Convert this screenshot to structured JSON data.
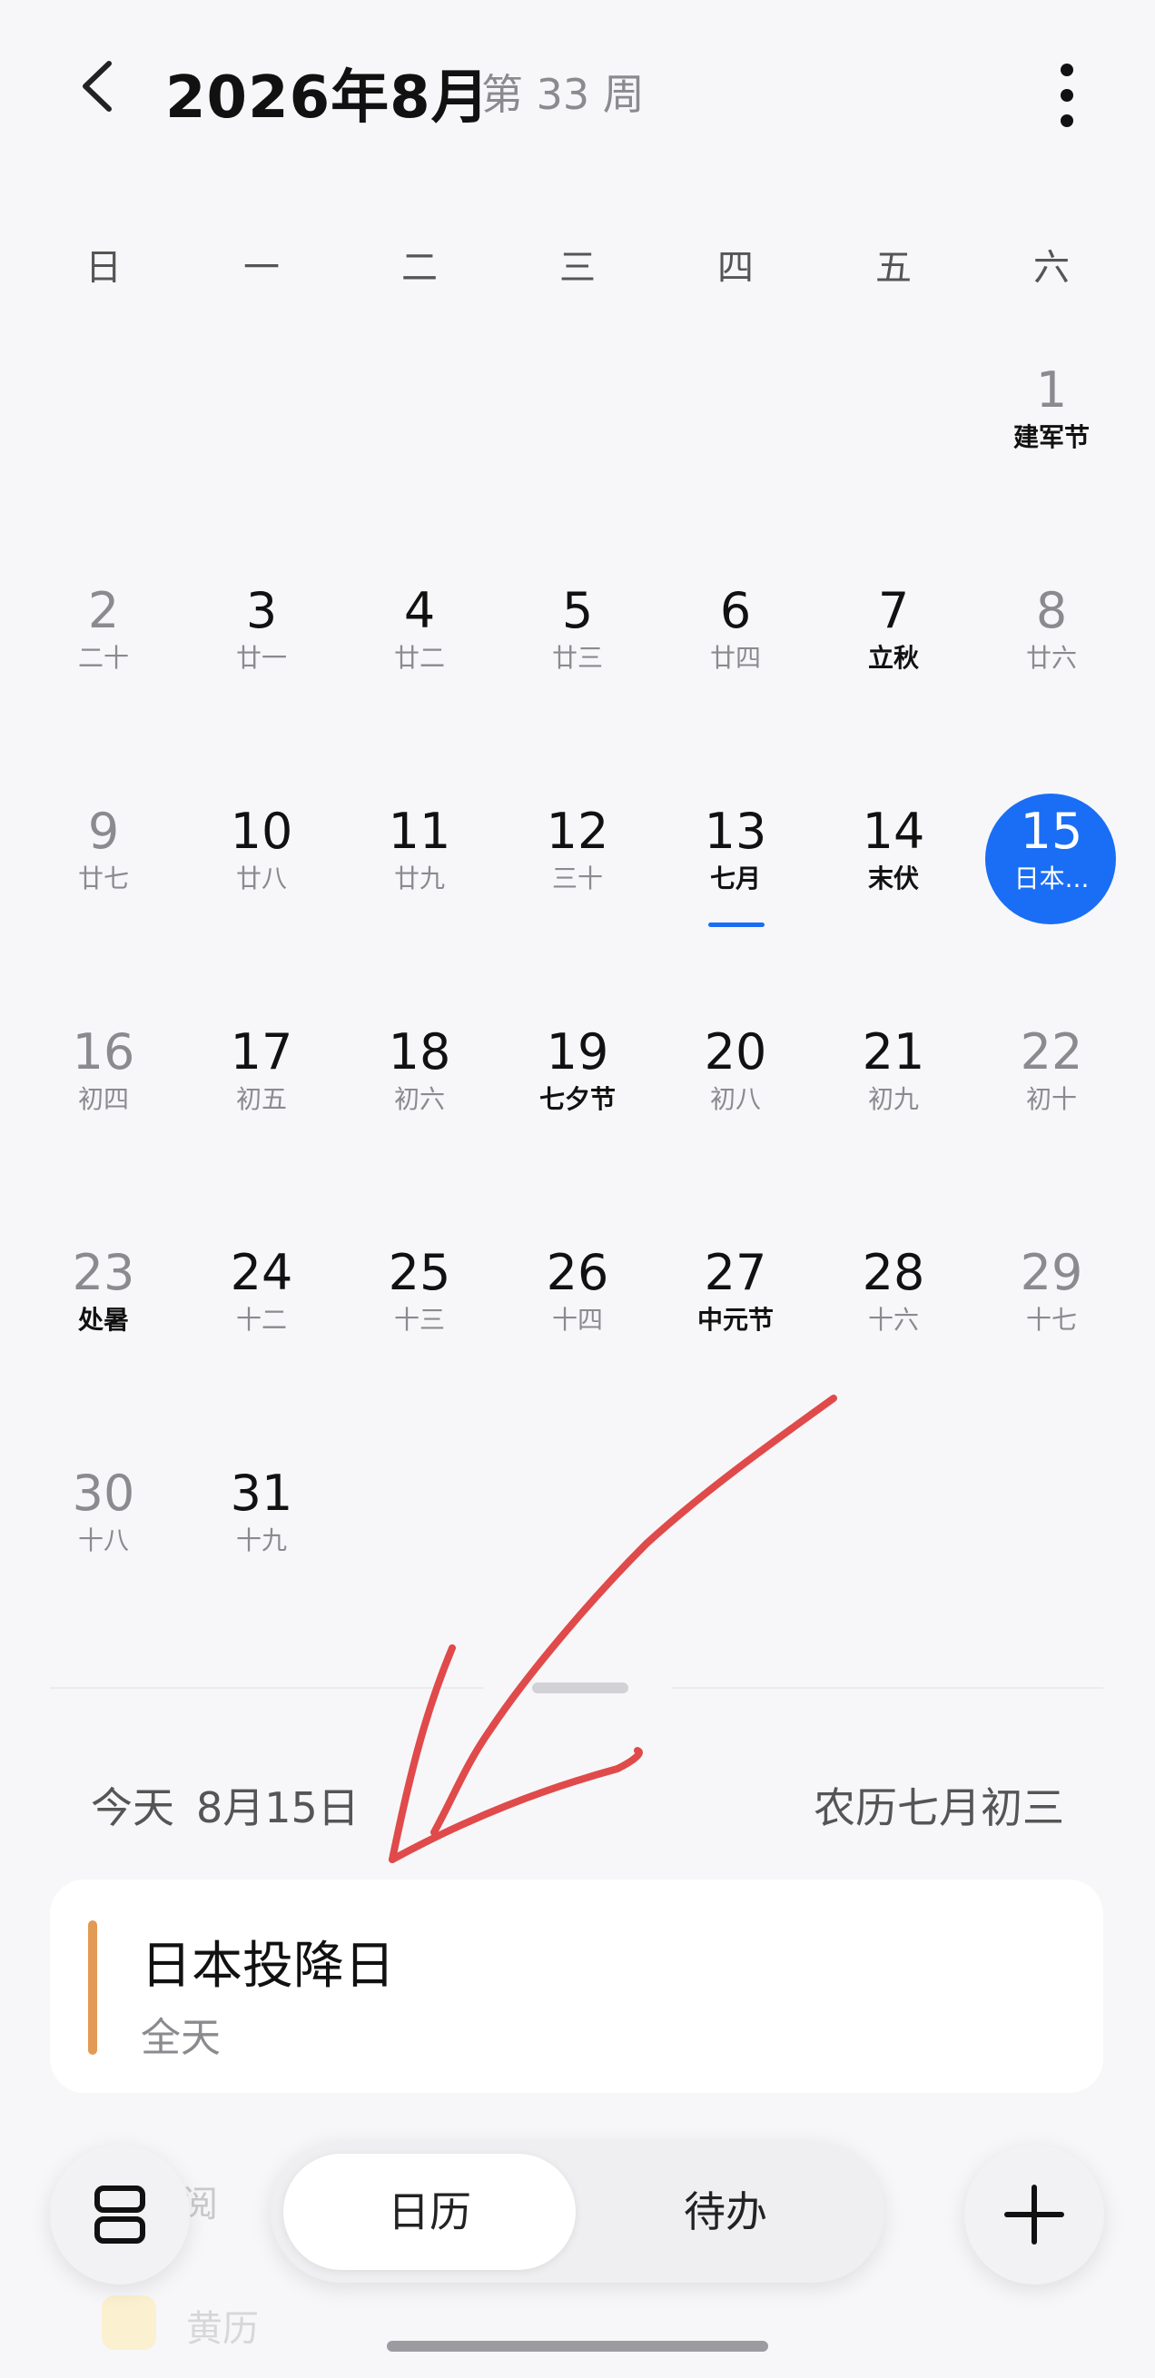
{
  "header": {
    "title": "2026年8月",
    "week": "第 33 周"
  },
  "weekdays": [
    "日",
    "一",
    "二",
    "三",
    "四",
    "五",
    "六"
  ],
  "calendar": [
    {
      "day": "1",
      "lunar": "建军节",
      "col": 6,
      "row": 0,
      "weekend": true,
      "hl": true
    },
    {
      "day": "2",
      "lunar": "二十",
      "col": 0,
      "row": 1,
      "weekend": true
    },
    {
      "day": "3",
      "lunar": "廿一",
      "col": 1,
      "row": 1
    },
    {
      "day": "4",
      "lunar": "廿二",
      "col": 2,
      "row": 1
    },
    {
      "day": "5",
      "lunar": "廿三",
      "col": 3,
      "row": 1
    },
    {
      "day": "6",
      "lunar": "廿四",
      "col": 4,
      "row": 1
    },
    {
      "day": "7",
      "lunar": "立秋",
      "col": 5,
      "row": 1,
      "hl": true
    },
    {
      "day": "8",
      "lunar": "廿六",
      "col": 6,
      "row": 1,
      "weekend": true
    },
    {
      "day": "9",
      "lunar": "廿七",
      "col": 0,
      "row": 2,
      "weekend": true
    },
    {
      "day": "10",
      "lunar": "廿八",
      "col": 1,
      "row": 2
    },
    {
      "day": "11",
      "lunar": "廿九",
      "col": 2,
      "row": 2
    },
    {
      "day": "12",
      "lunar": "三十",
      "col": 3,
      "row": 2
    },
    {
      "day": "13",
      "lunar": "七月",
      "col": 4,
      "row": 2,
      "hl": true,
      "underline": true
    },
    {
      "day": "14",
      "lunar": "末伏",
      "col": 5,
      "row": 2,
      "hl": true
    },
    {
      "day": "15",
      "lunar": "日本...",
      "col": 6,
      "row": 2,
      "today": true
    },
    {
      "day": "16",
      "lunar": "初四",
      "col": 0,
      "row": 3,
      "weekend": true
    },
    {
      "day": "17",
      "lunar": "初五",
      "col": 1,
      "row": 3
    },
    {
      "day": "18",
      "lunar": "初六",
      "col": 2,
      "row": 3
    },
    {
      "day": "19",
      "lunar": "七夕节",
      "col": 3,
      "row": 3,
      "hl": true
    },
    {
      "day": "20",
      "lunar": "初八",
      "col": 4,
      "row": 3
    },
    {
      "day": "21",
      "lunar": "初九",
      "col": 5,
      "row": 3
    },
    {
      "day": "22",
      "lunar": "初十",
      "col": 6,
      "row": 3,
      "weekend": true
    },
    {
      "day": "23",
      "lunar": "处暑",
      "col": 0,
      "row": 4,
      "weekend": true,
      "hl": true
    },
    {
      "day": "24",
      "lunar": "十二",
      "col": 1,
      "row": 4
    },
    {
      "day": "25",
      "lunar": "十三",
      "col": 2,
      "row": 4
    },
    {
      "day": "26",
      "lunar": "十四",
      "col": 3,
      "row": 4
    },
    {
      "day": "27",
      "lunar": "中元节",
      "col": 4,
      "row": 4,
      "hl": true
    },
    {
      "day": "28",
      "lunar": "十六",
      "col": 5,
      "row": 4
    },
    {
      "day": "29",
      "lunar": "十七",
      "col": 6,
      "row": 4,
      "weekend": true
    },
    {
      "day": "30",
      "lunar": "十八",
      "col": 0,
      "row": 5,
      "weekend": true
    },
    {
      "day": "31",
      "lunar": "十九",
      "col": 1,
      "row": 5
    }
  ],
  "today_panel": {
    "today": "今天",
    "date": "8月15日",
    "lunar": "农历七月初三"
  },
  "event": {
    "title": "日本投降日",
    "subtitle": "全天",
    "color": "#e29a55"
  },
  "behind": {
    "text1": "阅",
    "text2": "黄历"
  },
  "tabs": {
    "calendar": "日历",
    "todo": "待办"
  },
  "colors": {
    "accent": "#1a6ef5",
    "event": "#e29a55",
    "annotation": "#e04a4a"
  }
}
